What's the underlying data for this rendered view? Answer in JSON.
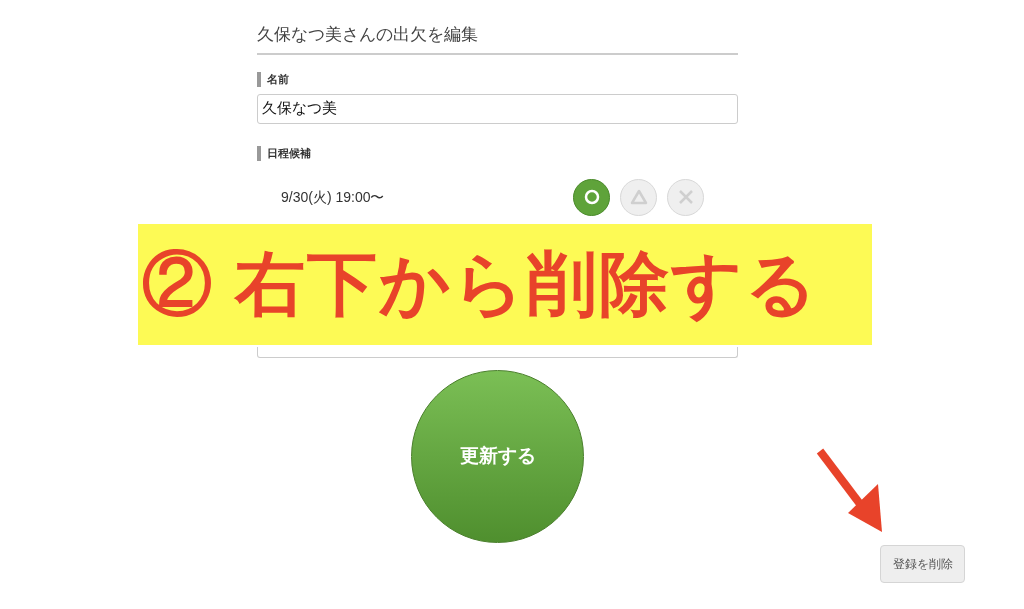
{
  "form": {
    "title": "久保なつ美さんの出欠を編集",
    "name_label": "名前",
    "name_value": "久保なつ美",
    "schedule_label": "日程候補",
    "schedule_rows": [
      {
        "date": "9/30(火) 19:00〜",
        "choices": [
          {
            "kind": "circle",
            "selected": true
          },
          {
            "kind": "triangle",
            "selected": false
          },
          {
            "kind": "cross",
            "selected": false
          }
        ]
      }
    ],
    "submit": "更新する"
  },
  "delete_button": "登録を削除",
  "annotation": {
    "text": "② 右下から削除する"
  }
}
